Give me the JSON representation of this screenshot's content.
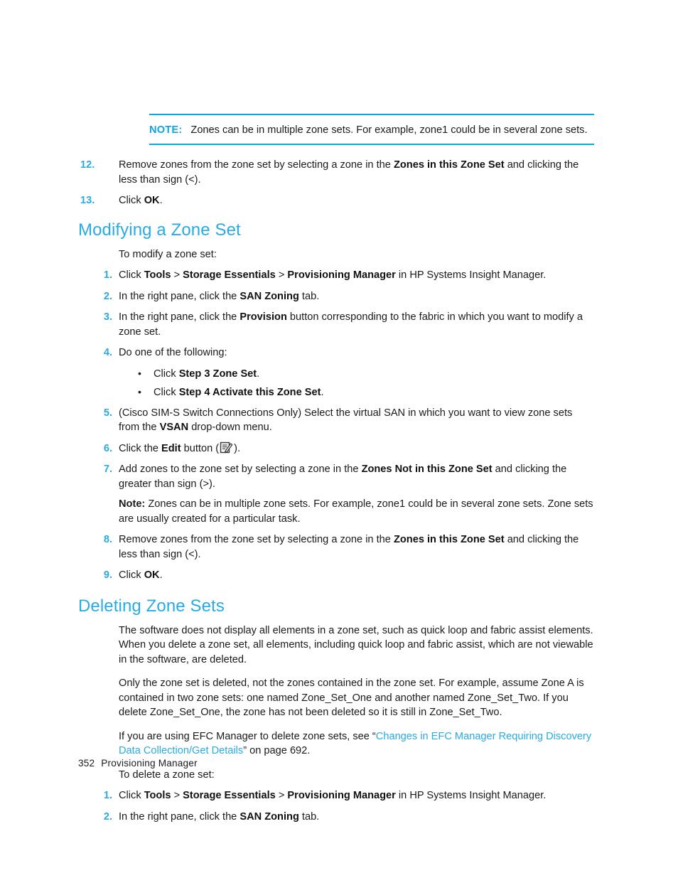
{
  "document": {
    "footer_page_number": "352",
    "footer_title": "Provisioning Manager",
    "accent_color": "#29abe2",
    "note_rule_color": "#0ea5e0",
    "body_color": "#1a1a1a"
  },
  "note_callout": {
    "label": "NOTE:",
    "text": "Zones can be in multiple zone sets. For example, zone1 could be in several zone sets."
  },
  "top_steps": [
    {
      "num": "12.",
      "parts": [
        {
          "t": "Remove zones from the zone set by selecting a zone in the ",
          "b": false
        },
        {
          "t": "Zones in this Zone Set",
          "b": true
        },
        {
          "t": " and clicking the less than sign (<).",
          "b": false
        }
      ]
    },
    {
      "num": "13.",
      "parts": [
        {
          "t": "Click ",
          "b": false
        },
        {
          "t": "OK",
          "b": true
        },
        {
          "t": ".",
          "b": false
        }
      ]
    }
  ],
  "section_modifying": {
    "heading": "Modifying a Zone Set",
    "intro": "To modify a zone set:",
    "steps": [
      {
        "num": "1.",
        "parts": [
          {
            "t": "Click ",
            "b": false
          },
          {
            "t": "Tools",
            "b": true
          },
          {
            "t": " > ",
            "b": false
          },
          {
            "t": "Storage Essentials",
            "b": true
          },
          {
            "t": " > ",
            "b": false
          },
          {
            "t": "Provisioning Manager",
            "b": true
          },
          {
            "t": " in HP Systems Insight Manager.",
            "b": false
          }
        ]
      },
      {
        "num": "2.",
        "parts": [
          {
            "t": "In the right pane, click the ",
            "b": false
          },
          {
            "t": "SAN Zoning",
            "b": true
          },
          {
            "t": " tab.",
            "b": false
          }
        ]
      },
      {
        "num": "3.",
        "parts": [
          {
            "t": "In the right pane, click the ",
            "b": false
          },
          {
            "t": "Provision",
            "b": true
          },
          {
            "t": " button corresponding to the fabric in which you want to modify a zone set.",
            "b": false
          }
        ]
      },
      {
        "num": "4.",
        "parts": [
          {
            "t": "Do one of the following:",
            "b": false
          }
        ]
      }
    ],
    "bullets": [
      {
        "parts": [
          {
            "t": "Click ",
            "b": false
          },
          {
            "t": "Step 3 Zone Set",
            "b": true
          },
          {
            "t": ".",
            "b": false
          }
        ]
      },
      {
        "parts": [
          {
            "t": "Click ",
            "b": false
          },
          {
            "t": "Step 4 Activate this Zone Set",
            "b": true
          },
          {
            "t": ".",
            "b": false
          }
        ]
      }
    ],
    "steps_after": [
      {
        "num": "5.",
        "parts": [
          {
            "t": "(Cisco SIM-S Switch Connections Only) Select the virtual SAN in which you want to view zone sets from the ",
            "b": false
          },
          {
            "t": "VSAN",
            "b": true
          },
          {
            "t": " drop-down menu.",
            "b": false
          }
        ]
      }
    ],
    "step_edit": {
      "num": "6.",
      "pre": "Click the ",
      "bold": "Edit",
      "mid": " button (",
      "post": ").",
      "icon_name": "edit-pencil-icon"
    },
    "step_add": {
      "num": "7.",
      "parts": [
        {
          "t": "Add zones to the zone set by selecting a zone in the ",
          "b": false
        },
        {
          "t": "Zones Not in this Zone Set",
          "b": true
        },
        {
          "t": " and clicking the greater than sign (>).",
          "b": false
        }
      ],
      "inline_note_label": "Note:",
      "inline_note_text": " Zones can be in multiple zone sets. For example, zone1 could be in several zone sets. Zone sets are usually created for a particular task."
    },
    "steps_tail": [
      {
        "num": "8.",
        "parts": [
          {
            "t": "Remove zones from the zone set by selecting a zone in the ",
            "b": false
          },
          {
            "t": "Zones in this Zone Set",
            "b": true
          },
          {
            "t": " and clicking the less than sign (<).",
            "b": false
          }
        ]
      },
      {
        "num": "9.",
        "parts": [
          {
            "t": "Click ",
            "b": false
          },
          {
            "t": "OK",
            "b": true
          },
          {
            "t": ".",
            "b": false
          }
        ]
      }
    ]
  },
  "section_deleting": {
    "heading": "Deleting Zone Sets",
    "para1": "The software does not display all elements in a zone set, such as quick loop and fabric assist elements. When you delete a zone set, all elements, including quick loop and fabric assist, which are not viewable in the software, are deleted.",
    "para2": "Only the zone set is deleted, not the zones contained in the zone set. For example, assume Zone A is contained in two zone sets: one named Zone_Set_One and another named Zone_Set_Two. If you delete Zone_Set_One, the zone has not been deleted so it is still in Zone_Set_Two.",
    "para3_pre": "If you are using EFC Manager to delete zone sets, see “",
    "para3_link": "Changes in EFC Manager Requiring Discovery Data Collection/Get Details",
    "para3_post": "” on page 692.",
    "intro": "To delete a zone set:",
    "steps": [
      {
        "num": "1.",
        "parts": [
          {
            "t": "Click ",
            "b": false
          },
          {
            "t": "Tools",
            "b": true
          },
          {
            "t": " > ",
            "b": false
          },
          {
            "t": "Storage Essentials",
            "b": true
          },
          {
            "t": " > ",
            "b": false
          },
          {
            "t": "Provisioning Manager",
            "b": true
          },
          {
            "t": " in HP Systems Insight Manager.",
            "b": false
          }
        ]
      },
      {
        "num": "2.",
        "parts": [
          {
            "t": "In the right pane, click the ",
            "b": false
          },
          {
            "t": "SAN Zoning",
            "b": true
          },
          {
            "t": " tab.",
            "b": false
          }
        ]
      }
    ]
  }
}
